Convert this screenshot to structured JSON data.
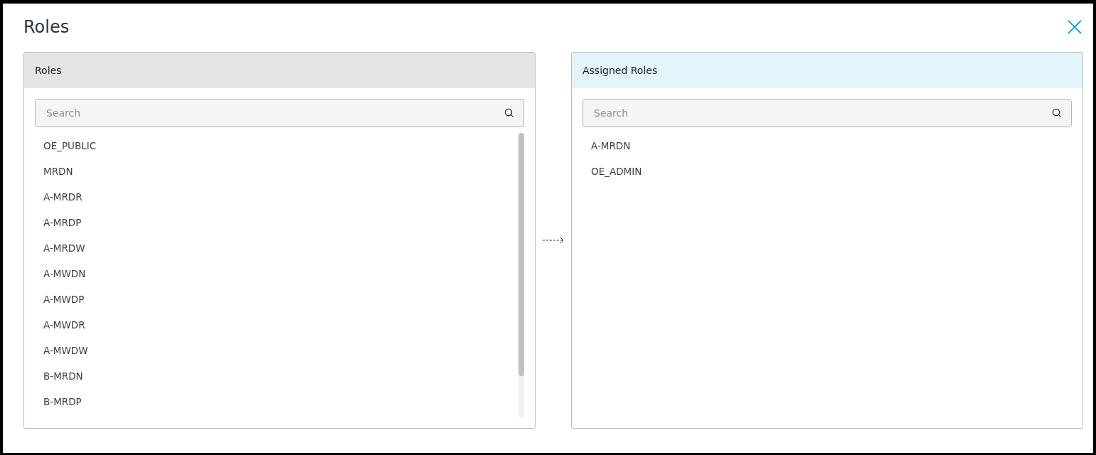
{
  "dialog": {
    "title": "Roles"
  },
  "available_panel": {
    "title": "Roles",
    "search": {
      "placeholder": "Search"
    },
    "items": [
      "OE_PUBLIC",
      "MRDN",
      "A-MRDR",
      "A-MRDP",
      "A-MRDW",
      "A-MWDN",
      "A-MWDP",
      "A-MWDR",
      "A-MWDW",
      "B-MRDN",
      "B-MRDP"
    ]
  },
  "assigned_panel": {
    "title": "Assigned Roles",
    "search": {
      "placeholder": "Search"
    },
    "items": [
      "A-MRDN",
      "OE_ADMIN"
    ]
  }
}
